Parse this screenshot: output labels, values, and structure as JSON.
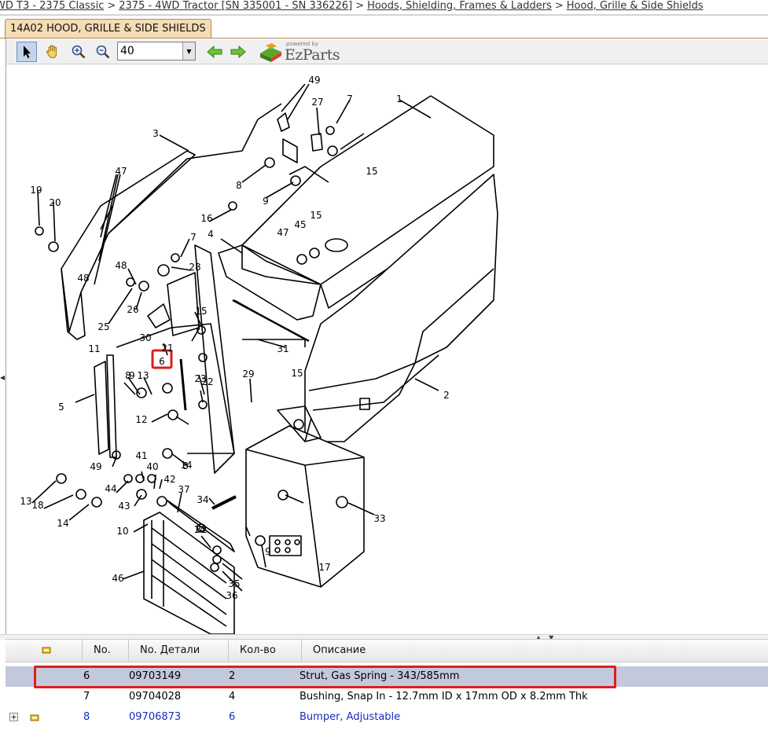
{
  "breadcrumb": {
    "items": [
      "WD T3 - 2375 Classic",
      "2375 - 4WD Tractor [SN 335001 - SN 336226]",
      "Hoods, Shielding, Frames & Ladders",
      "Hood, Grille & Side Shields"
    ],
    "separator": ">"
  },
  "tab": {
    "label": "14A02 HOOD, GRILLE & SIDE SHIELDS"
  },
  "toolbar": {
    "zoom_value": "40",
    "logo_small": "powered by",
    "logo_text": "EzParts"
  },
  "colors": {
    "accent_tab": "#f4dcb4",
    "selection": "#c2c9dd",
    "highlight": "#e01c1c",
    "link_blue": "#1a2bb8"
  },
  "drawing": {
    "callouts": [
      "1",
      "2",
      "3",
      "4",
      "5",
      "6",
      "7",
      "7",
      "8",
      "8",
      "8",
      "9",
      "9",
      "9",
      "10",
      "11",
      "12",
      "13",
      "13",
      "14",
      "14",
      "14",
      "15",
      "15",
      "15",
      "15",
      "16",
      "17",
      "18",
      "19",
      "20",
      "21",
      "22",
      "23",
      "25",
      "26",
      "27",
      "28",
      "29",
      "30",
      "31",
      "32",
      "33",
      "34",
      "35",
      "36",
      "37",
      "40",
      "41",
      "42",
      "43",
      "44",
      "45",
      "46",
      "47",
      "47",
      "48",
      "48",
      "49",
      "49"
    ],
    "highlighted_callout": "6"
  },
  "table": {
    "columns": [
      "No.",
      "No. Детали",
      "Кол-во",
      "Описание"
    ],
    "rows": [
      {
        "no": "6",
        "part": "09703149",
        "qty": "2",
        "desc": "Strut, Gas Spring - 343/585mm"
      },
      {
        "no": "7",
        "part": "09704028",
        "qty": "4",
        "desc": "Bushing, Snap In - 12.7mm ID x 17mm OD x 8.2mm Thk"
      },
      {
        "no": "8",
        "part": "09706873",
        "qty": "6",
        "desc": "Bumper, Adjustable"
      }
    ]
  }
}
